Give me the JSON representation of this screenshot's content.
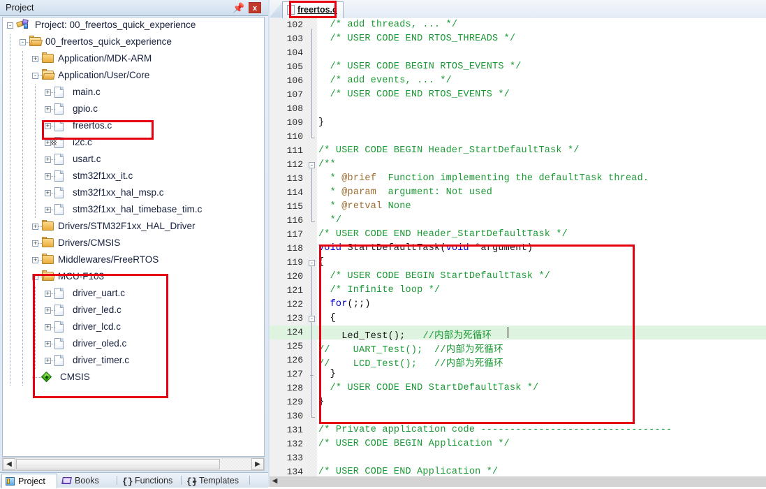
{
  "project_pane": {
    "title": "Project",
    "pin_icon": "pin-icon",
    "close_label": "x",
    "tree": [
      {
        "label": "Project: 00_freertos_quick_experience",
        "indent": 0,
        "icon": "project-icon",
        "expander": "-"
      },
      {
        "label": "00_freertos_quick_experience",
        "indent": 1,
        "icon": "folder-open-special-icon",
        "expander": "-"
      },
      {
        "label": "Application/MDK-ARM",
        "indent": 2,
        "icon": "folder-closed-icon",
        "expander": "+"
      },
      {
        "label": "Application/User/Core",
        "indent": 2,
        "icon": "folder-open-icon",
        "expander": "-"
      },
      {
        "label": "main.c",
        "indent": 3,
        "icon": "c-file-icon",
        "expander": "+"
      },
      {
        "label": "gpio.c",
        "indent": 3,
        "icon": "c-file-icon",
        "expander": "+"
      },
      {
        "label": "freertos.c",
        "indent": 3,
        "icon": "c-file-icon",
        "expander": "+"
      },
      {
        "label": "i2c.c",
        "indent": 3,
        "icon": "c-file-modified-icon",
        "expander": "+"
      },
      {
        "label": "usart.c",
        "indent": 3,
        "icon": "c-file-icon",
        "expander": "+"
      },
      {
        "label": "stm32f1xx_it.c",
        "indent": 3,
        "icon": "c-file-icon",
        "expander": "+"
      },
      {
        "label": "stm32f1xx_hal_msp.c",
        "indent": 3,
        "icon": "c-file-icon",
        "expander": "+"
      },
      {
        "label": "stm32f1xx_hal_timebase_tim.c",
        "indent": 3,
        "icon": "c-file-icon",
        "expander": "+"
      },
      {
        "label": "Drivers/STM32F1xx_HAL_Driver",
        "indent": 2,
        "icon": "folder-closed-icon",
        "expander": "+"
      },
      {
        "label": "Drivers/CMSIS",
        "indent": 2,
        "icon": "folder-closed-icon",
        "expander": "+"
      },
      {
        "label": "Middlewares/FreeRTOS",
        "indent": 2,
        "icon": "folder-closed-icon",
        "expander": "+"
      },
      {
        "label": "MCU-F103",
        "indent": 2,
        "icon": "folder-open-icon",
        "expander": "-"
      },
      {
        "label": "driver_uart.c",
        "indent": 3,
        "icon": "c-file-icon",
        "expander": "+"
      },
      {
        "label": "driver_led.c",
        "indent": 3,
        "icon": "c-file-icon",
        "expander": "+"
      },
      {
        "label": "driver_lcd.c",
        "indent": 3,
        "icon": "c-file-icon",
        "expander": "+"
      },
      {
        "label": "driver_oled.c",
        "indent": 3,
        "icon": "c-file-icon",
        "expander": "+"
      },
      {
        "label": "driver_timer.c",
        "indent": 3,
        "icon": "c-file-icon",
        "expander": "+"
      },
      {
        "label": "CMSIS",
        "indent": 2,
        "icon": "cmsis-diamond-icon",
        "expander": ""
      }
    ],
    "bottom_tabs": [
      {
        "label": "Project",
        "icon": "project-tab-icon",
        "active": true
      },
      {
        "label": "Books",
        "icon": "books-icon",
        "active": false
      },
      {
        "label": "Functions",
        "icon": "braces-icon",
        "active": false
      },
      {
        "label": "Templates",
        "icon": "templates-icon",
        "active": false
      }
    ]
  },
  "editor": {
    "tab": {
      "label": "freertos.c",
      "icon": "c-file-icon",
      "active": true
    },
    "current_line": 124,
    "lines": [
      {
        "n": 102,
        "segs": [
          {
            "t": "  /* add threads, ... */",
            "c": "cmt"
          }
        ]
      },
      {
        "n": 103,
        "segs": [
          {
            "t": "  /* USER CODE END RTOS_THREADS */",
            "c": "cmt"
          }
        ]
      },
      {
        "n": 104,
        "segs": [
          {
            "t": "",
            "c": "plain"
          }
        ]
      },
      {
        "n": 105,
        "segs": [
          {
            "t": "  /* USER CODE BEGIN RTOS_EVENTS */",
            "c": "cmt"
          }
        ]
      },
      {
        "n": 106,
        "segs": [
          {
            "t": "  /* add events, ... */",
            "c": "cmt"
          }
        ]
      },
      {
        "n": 107,
        "segs": [
          {
            "t": "  /* USER CODE END RTOS_EVENTS */",
            "c": "cmt"
          }
        ]
      },
      {
        "n": 108,
        "segs": [
          {
            "t": "",
            "c": "plain"
          }
        ]
      },
      {
        "n": 109,
        "segs": [
          {
            "t": "}",
            "c": "plain"
          }
        ]
      },
      {
        "n": 110,
        "segs": [
          {
            "t": "",
            "c": "plain"
          }
        ]
      },
      {
        "n": 111,
        "segs": [
          {
            "t": "/* USER CODE BEGIN Header_StartDefaultTask */",
            "c": "cmt"
          }
        ]
      },
      {
        "n": 112,
        "segs": [
          {
            "t": "/**",
            "c": "cmt"
          }
        ]
      },
      {
        "n": 113,
        "segs": [
          {
            "t": "  * ",
            "c": "cmt"
          },
          {
            "t": "@brief",
            "c": "doc-tag"
          },
          {
            "t": "  Function implementing the defaultTask thread.",
            "c": "cmt"
          }
        ]
      },
      {
        "n": 114,
        "segs": [
          {
            "t": "  * ",
            "c": "cmt"
          },
          {
            "t": "@param",
            "c": "doc-tag"
          },
          {
            "t": "  argument: Not used",
            "c": "cmt"
          }
        ]
      },
      {
        "n": 115,
        "segs": [
          {
            "t": "  * ",
            "c": "cmt"
          },
          {
            "t": "@retval",
            "c": "doc-tag"
          },
          {
            "t": " None",
            "c": "cmt"
          }
        ]
      },
      {
        "n": 116,
        "segs": [
          {
            "t": "  */",
            "c": "cmt"
          }
        ]
      },
      {
        "n": 117,
        "segs": [
          {
            "t": "/* USER CODE END Header_StartDefaultTask */",
            "c": "cmt"
          }
        ]
      },
      {
        "n": 118,
        "segs": [
          {
            "t": "void",
            "c": "kw"
          },
          {
            "t": " StartDefaultTask(",
            "c": "plain"
          },
          {
            "t": "void",
            "c": "kw"
          },
          {
            "t": " *argument)",
            "c": "plain"
          }
        ]
      },
      {
        "n": 119,
        "segs": [
          {
            "t": "{",
            "c": "plain"
          }
        ]
      },
      {
        "n": 120,
        "segs": [
          {
            "t": "  /* USER CODE BEGIN StartDefaultTask */",
            "c": "cmt"
          }
        ]
      },
      {
        "n": 121,
        "segs": [
          {
            "t": "  /* Infinite loop */",
            "c": "cmt"
          }
        ]
      },
      {
        "n": 122,
        "segs": [
          {
            "t": "  for",
            "c": "kw"
          },
          {
            "t": "(;;)",
            "c": "plain"
          }
        ]
      },
      {
        "n": 123,
        "segs": [
          {
            "t": "  {",
            "c": "plain"
          }
        ]
      },
      {
        "n": 124,
        "segs": [
          {
            "t": "    Led_Test();   ",
            "c": "plain"
          },
          {
            "t": "//内部为死循环",
            "c": "cmt"
          }
        ]
      },
      {
        "n": 125,
        "segs": [
          {
            "t": "//    UART_Test();  //内部为死循环",
            "c": "cmt"
          }
        ]
      },
      {
        "n": 126,
        "segs": [
          {
            "t": "//    LCD_Test();   //内部为死循环",
            "c": "cmt"
          }
        ]
      },
      {
        "n": 127,
        "segs": [
          {
            "t": "  }",
            "c": "plain"
          }
        ]
      },
      {
        "n": 128,
        "segs": [
          {
            "t": "  /* USER CODE END StartDefaultTask */",
            "c": "cmt"
          }
        ]
      },
      {
        "n": 129,
        "segs": [
          {
            "t": "}",
            "c": "plain"
          }
        ]
      },
      {
        "n": 130,
        "segs": [
          {
            "t": "",
            "c": "plain"
          }
        ]
      },
      {
        "n": 131,
        "segs": [
          {
            "t": "/* Private application code ---------------------------------",
            "c": "cmt"
          }
        ]
      },
      {
        "n": 132,
        "segs": [
          {
            "t": "/* USER CODE BEGIN Application */",
            "c": "cmt"
          }
        ]
      },
      {
        "n": 133,
        "segs": [
          {
            "t": "",
            "c": "plain"
          }
        ]
      },
      {
        "n": 134,
        "segs": [
          {
            "t": "/* USER CODE END Application */",
            "c": "cmt"
          }
        ]
      }
    ]
  },
  "annotations": {
    "color": "#e60012",
    "boxes": [
      "editor-tab-freertos",
      "tree-item-freertos",
      "tree-group-mcu-f103",
      "code-block-startdefaulttask"
    ]
  }
}
